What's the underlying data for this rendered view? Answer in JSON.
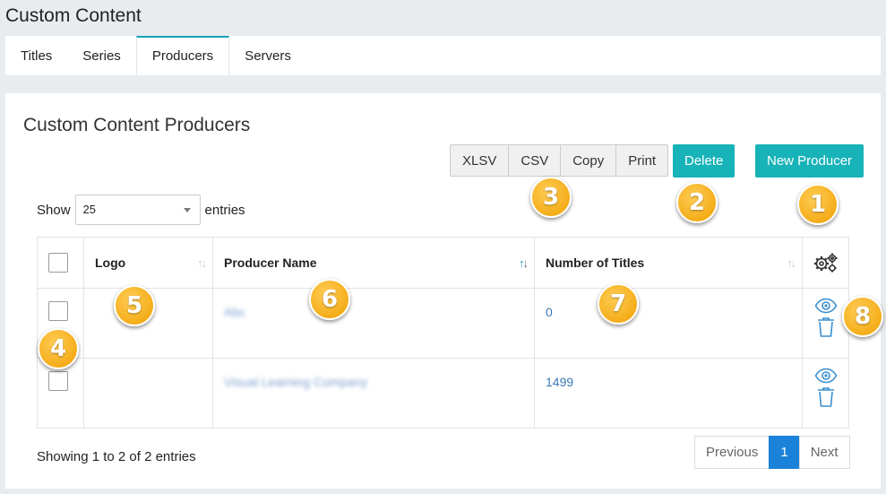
{
  "page": {
    "title": "Custom Content"
  },
  "tabs": [
    {
      "label": "Titles"
    },
    {
      "label": "Series"
    },
    {
      "label": "Producers"
    },
    {
      "label": "Servers"
    }
  ],
  "card": {
    "title": "Custom Content Producers"
  },
  "toolbar": {
    "export_buttons": [
      "XLSV",
      "CSV",
      "Copy",
      "Print"
    ],
    "delete_label": "Delete",
    "new_label": "New Producer"
  },
  "entries": {
    "show_label": "Show",
    "value": "25",
    "suffix": "entries"
  },
  "table": {
    "columns": {
      "logo": "Logo",
      "producer_name": "Producer Name",
      "number_of_titles": "Number of Titles"
    },
    "rows": [
      {
        "producer": "Abc",
        "count": "0"
      },
      {
        "producer": "Visual Learning Company",
        "count": "1499"
      }
    ]
  },
  "footer": {
    "showing": "Showing 1 to 2 of 2 entries"
  },
  "pagination": {
    "previous": "Previous",
    "current": "1",
    "next": "Next"
  },
  "callouts": [
    "1",
    "2",
    "3",
    "4",
    "5",
    "6",
    "7",
    "8"
  ],
  "colors": {
    "accent": "#17b3b8",
    "callout": "#f0a000",
    "link": "#3a7bb7",
    "page_active": "#1a82d8"
  }
}
